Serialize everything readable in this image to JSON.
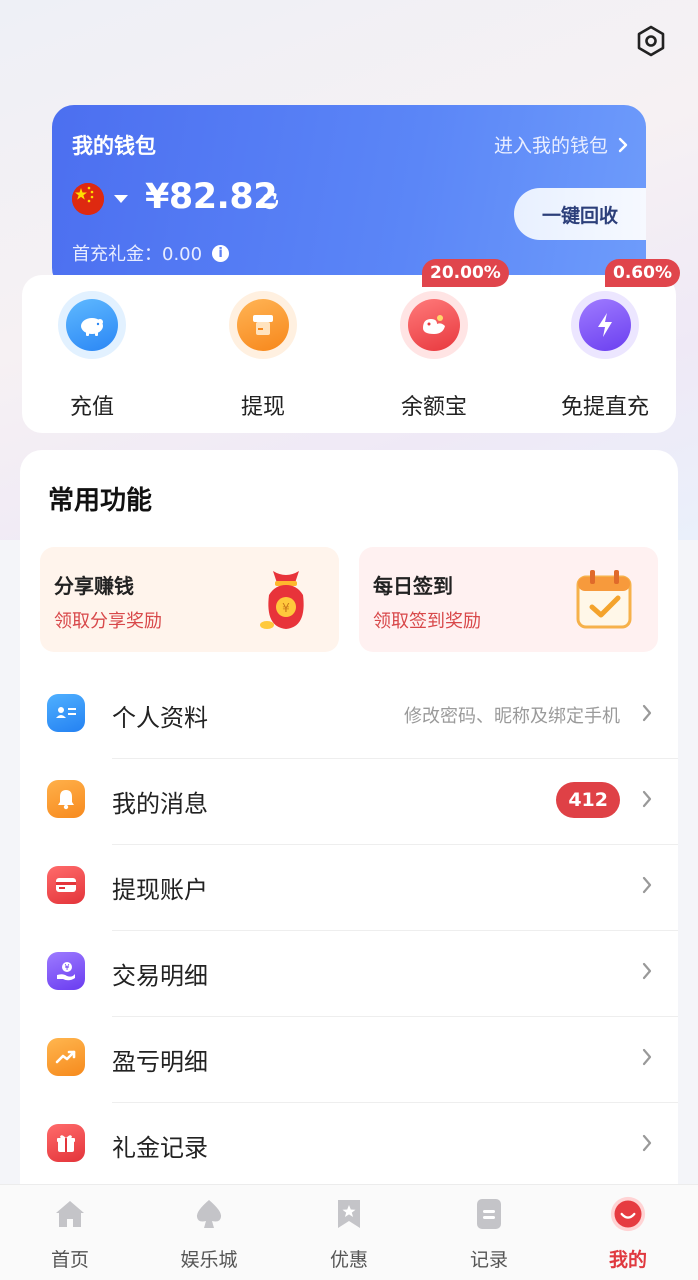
{
  "wallet": {
    "title": "我的钱包",
    "enter_label": "进入我的钱包",
    "balance": "¥82.82",
    "recover_label": "一键回收",
    "bonus_label": "首充礼金：0.00"
  },
  "actions": [
    {
      "label": "充值",
      "icon": "piggy-bank-icon"
    },
    {
      "label": "提现",
      "icon": "withdraw-icon"
    },
    {
      "label": "余额宝",
      "icon": "balance-treasure-icon",
      "badge": "20.00%"
    },
    {
      "label": "免提直充",
      "icon": "lightning-icon",
      "badge": "0.60%"
    }
  ],
  "features": {
    "title": "常用功能",
    "promos": [
      {
        "title": "分享赚钱",
        "subtitle": "领取分享奖励"
      },
      {
        "title": "每日签到",
        "subtitle": "领取签到奖励"
      }
    ],
    "menu": [
      {
        "label": "个人资料",
        "hint": "修改密码、昵称及绑定手机"
      },
      {
        "label": "我的消息",
        "count": "412"
      },
      {
        "label": "提现账户"
      },
      {
        "label": "交易明细"
      },
      {
        "label": "盈亏明细"
      },
      {
        "label": "礼金记录"
      }
    ]
  },
  "tabbar": [
    {
      "label": "首页"
    },
    {
      "label": "娱乐城"
    },
    {
      "label": "优惠"
    },
    {
      "label": "记录"
    },
    {
      "label": "我的",
      "active": true
    }
  ],
  "colors": {
    "accent_red": "#e0393f",
    "wallet_blue": "#5b86f7"
  }
}
